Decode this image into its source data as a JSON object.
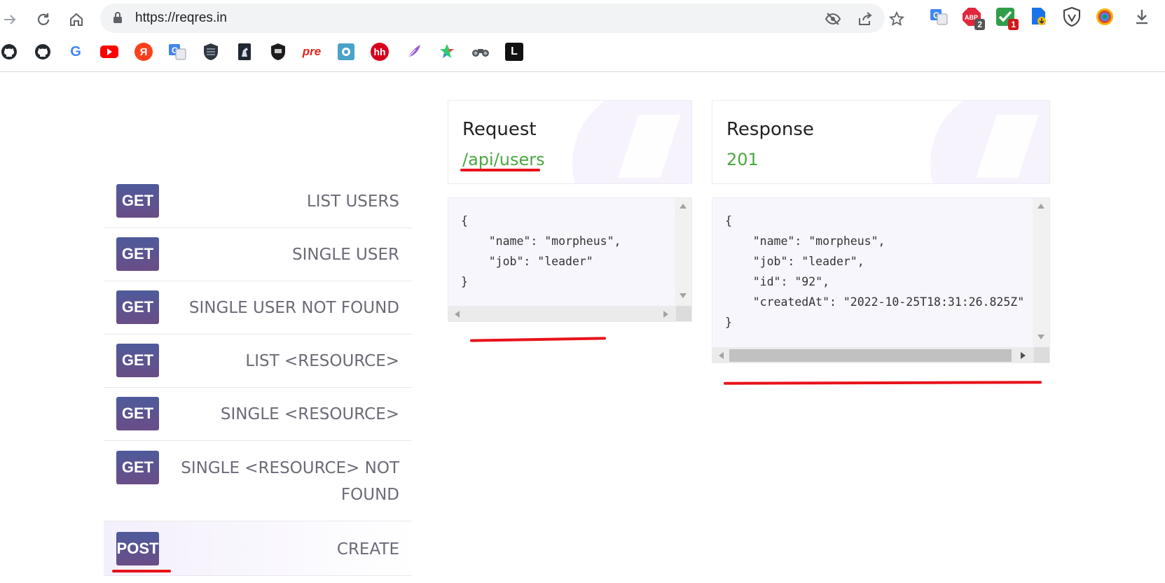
{
  "browser": {
    "url": "https://reqres.in",
    "extensions": [
      {
        "name": "translate-icon"
      },
      {
        "name": "adblock-icon",
        "badge": "2",
        "badge_color": "#555555"
      },
      {
        "name": "checker-icon",
        "badge": "1",
        "badge_color": "#d11a1a"
      },
      {
        "name": "doc-download-icon"
      },
      {
        "name": "shield-v-icon"
      },
      {
        "name": "color-picker-icon"
      },
      {
        "name": "download-icon"
      }
    ],
    "bookmarks": {
      "pre_label": "pre",
      "hh_label": "hh",
      "l_label": "L",
      "g_label": "G",
      "ya_label": "Я"
    }
  },
  "endpoints": [
    {
      "method": "GET",
      "label": "LIST USERS"
    },
    {
      "method": "GET",
      "label": "SINGLE USER"
    },
    {
      "method": "GET",
      "label": "SINGLE USER NOT FOUND"
    },
    {
      "method": "GET",
      "label": "LIST <RESOURCE>"
    },
    {
      "method": "GET",
      "label": "SINGLE <RESOURCE>"
    },
    {
      "method": "GET",
      "label": "SINGLE <RESOURCE> NOT",
      "label2": "FOUND"
    },
    {
      "method": "POST",
      "label": "CREATE"
    }
  ],
  "request": {
    "title": "Request",
    "path": "/api/users",
    "body_lines": [
      "{",
      "    \"name\": \"morpheus\",",
      "    \"job\": \"leader\"",
      "}"
    ]
  },
  "response": {
    "title": "Response",
    "status": "201",
    "body_lines": [
      "{",
      "    \"name\": \"morpheus\",",
      "    \"job\": \"leader\",",
      "    \"id\": \"92\",",
      "    \"createdAt\": \"2022-10-25T18:31:26.825Z\"",
      "}"
    ]
  },
  "colors": {
    "accent_green": "#4aa840",
    "method_gradient_top": "#4e5b9b",
    "method_gradient_bottom": "#6a4d86",
    "annotation_red": "#e8121a"
  }
}
